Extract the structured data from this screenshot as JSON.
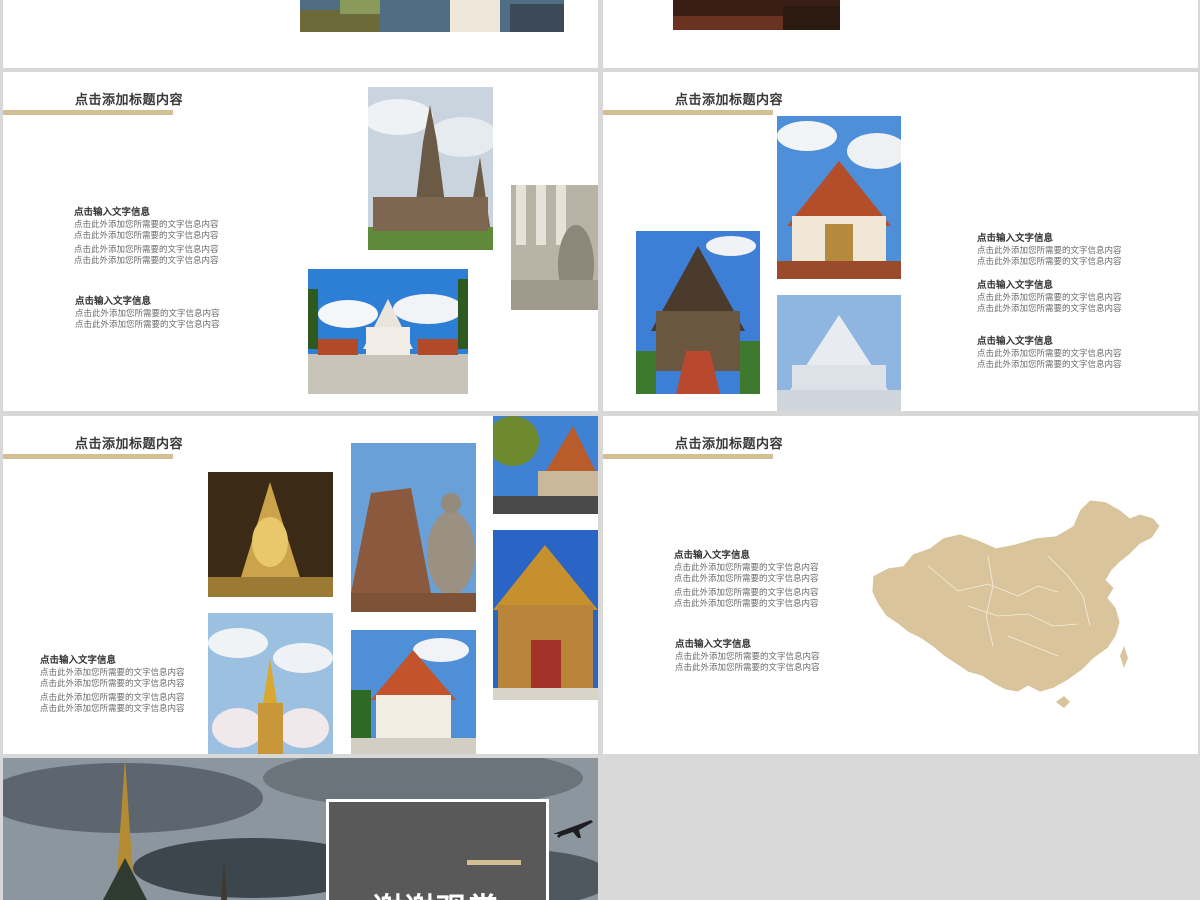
{
  "slides": {
    "s3": {
      "title": "点击添加标题内容",
      "blocks": [
        {
          "heading": "点击输入文字信息",
          "lines": [
            "点击此外添加您所需要的文字信息内容",
            "点击此外添加您所需要的文字信息内容",
            "点击此外添加您所需要的文字信息内容",
            "点击此外添加您所需要的文字信息内容"
          ]
        },
        {
          "heading": "点击输入文字信息",
          "lines": [
            "点击此外添加您所需要的文字信息内容",
            "点击此外添加您所需要的文字信息内容"
          ]
        }
      ]
    },
    "s4": {
      "title": "点击添加标题内容",
      "blocks": [
        {
          "heading": "点击输入文字信息",
          "lines": [
            "点击此外添加您所需要的文字信息内容",
            "点击此外添加您所需要的文字信息内容"
          ]
        },
        {
          "heading": "点击输入文字信息",
          "lines": [
            "点击此外添加您所需要的文字信息内容",
            "点击此外添加您所需要的文字信息内容"
          ]
        },
        {
          "heading": "点击输入文字信息",
          "lines": [
            "点击此外添加您所需要的文字信息内容",
            "点击此外添加您所需要的文字信息内容"
          ]
        }
      ]
    },
    "s5": {
      "title": "点击添加标题内容",
      "blocks": [
        {
          "heading": "点击输入文字信息",
          "lines": [
            "点击此外添加您所需要的文字信息内容",
            "点击此外添加您所需要的文字信息内容",
            "点击此外添加您所需要的文字信息内容",
            "点击此外添加您所需要的文字信息内容"
          ]
        }
      ]
    },
    "s6": {
      "title": "点击添加标题内容",
      "blocks": [
        {
          "heading": "点击输入文字信息",
          "lines": [
            "点击此外添加您所需要的文字信息内容",
            "点击此外添加您所需要的文字信息内容",
            "点击此外添加您所需要的文字信息内容",
            "点击此外添加您所需要的文字信息内容"
          ]
        },
        {
          "heading": "点击输入文字信息",
          "lines": [
            "点击此外添加您所需要的文字信息内容",
            "点击此外添加您所需要的文字信息内容"
          ]
        }
      ]
    },
    "s7": {
      "thanks": "谢谢观赏"
    }
  },
  "colors": {
    "accent": "#d2bf94",
    "map": "#d9c49c",
    "background": "#d8d8d8"
  }
}
